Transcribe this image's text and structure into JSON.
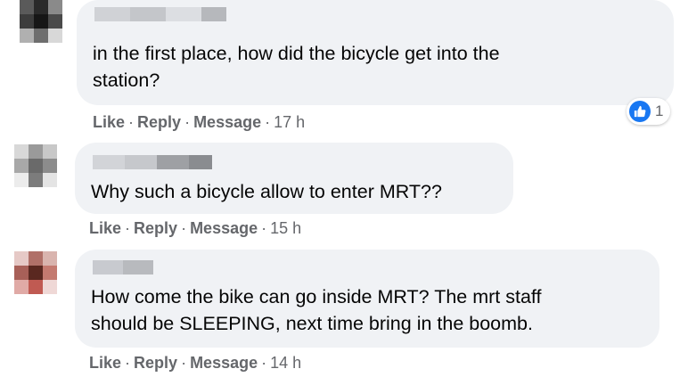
{
  "accent_color": "#1877f2",
  "comments": [
    {
      "text": "in the first place, how did the bicycle get into the\nstation?",
      "actions": {
        "like": "Like",
        "reply": "Reply",
        "message": "Message",
        "time": "17 h"
      },
      "reaction": {
        "icon": "thumbs-up-icon",
        "count": "1"
      }
    },
    {
      "text": "Why such a bicycle allow to enter MRT??",
      "actions": {
        "like": "Like",
        "reply": "Reply",
        "message": "Message",
        "time": "15 h"
      }
    },
    {
      "text": "How come the bike can go inside MRT? The mrt staff\nshould be SLEEPING, next time bring in the boomb.",
      "actions": {
        "like": "Like",
        "reply": "Reply",
        "message": "Message",
        "time": "14 h"
      }
    }
  ]
}
